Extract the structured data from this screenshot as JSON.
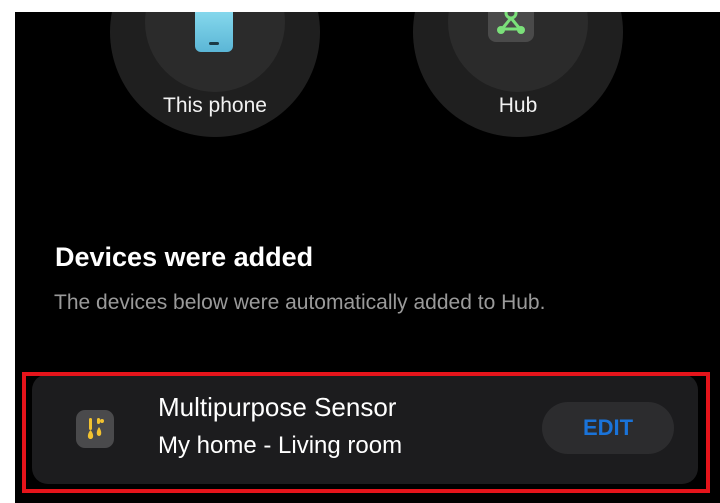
{
  "devices_top": {
    "phone": {
      "label": "This phone",
      "icon": "smartphone-icon"
    },
    "hub": {
      "label": "Hub",
      "icon": "hub-icon"
    }
  },
  "section": {
    "title": "Devices were added",
    "description": "The devices below were automatically added to Hub."
  },
  "device_card": {
    "icon": "multipurpose-sensor-icon",
    "name": "Multipurpose Sensor",
    "location": "My home - Living room",
    "edit_label": "EDIT"
  },
  "colors": {
    "background": "#000000",
    "card": "#1c1c1e",
    "accent": "#1a73d9",
    "highlight": "#e5141b",
    "secondary_text": "#9a9a9a"
  }
}
